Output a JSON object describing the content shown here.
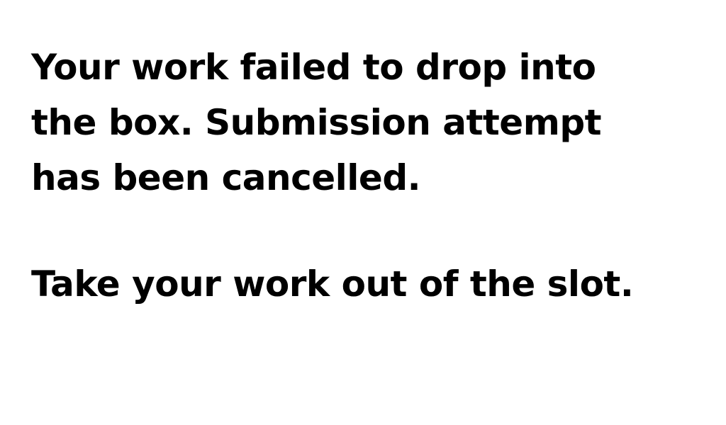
{
  "kiosk": {
    "message_lines": [
      "Your work failed to drop into",
      "the box. Submission attempt",
      "has been cancelled."
    ],
    "instruction": "Take your work out of the slot."
  },
  "colors": {
    "background": "#ffffff",
    "text": "#000000"
  }
}
